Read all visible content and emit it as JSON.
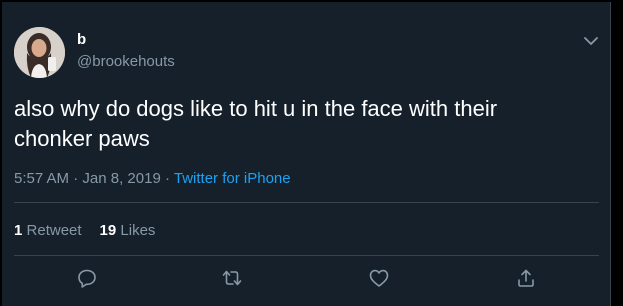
{
  "tweet": {
    "display_name": "b",
    "handle": "@brookehouts",
    "text": "also why do dogs like to hit u in the face with their chonker paws",
    "time": "5:57 AM",
    "separator": "·",
    "date": "Jan 8, 2019",
    "source": "Twitter for iPhone",
    "retweet_count": "1",
    "retweet_label": "Retweet",
    "like_count": "19",
    "like_label": "Likes"
  },
  "colors": {
    "background": "#15202b",
    "text": "#ffffff",
    "secondary_text": "#8899a6",
    "link": "#1da1f2",
    "divider": "#38444d"
  },
  "icons": {
    "menu": "chevron-down-icon",
    "reply": "reply-icon",
    "retweet": "retweet-icon",
    "like": "heart-icon",
    "share": "share-icon"
  }
}
